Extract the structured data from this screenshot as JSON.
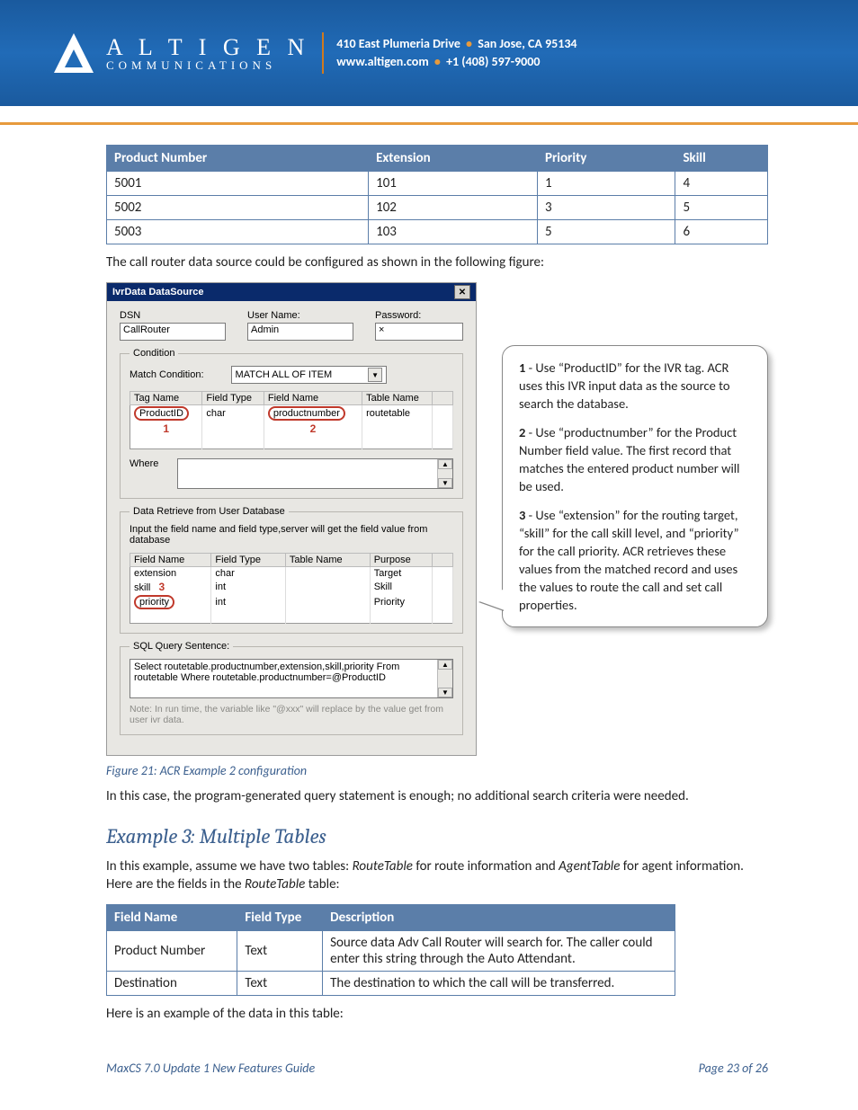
{
  "header": {
    "company_top": "A L T I G E N",
    "company_sub": "COMMUNICATIONS",
    "address_line1_a": "410 East Plumeria Drive",
    "address_line1_b": "San Jose, CA 95134",
    "address_line2_a": "www.altigen.com",
    "address_line2_b": "+1 (408) 597-9000"
  },
  "table1": {
    "headers": [
      "Product Number",
      "Extension",
      "Priority",
      "Skill"
    ],
    "rows": [
      [
        "5001",
        "101",
        "1",
        "4"
      ],
      [
        "5002",
        "102",
        "3",
        "5"
      ],
      [
        "5003",
        "103",
        "5",
        "6"
      ]
    ]
  },
  "para_after_t1": "The call router data source could be configured as shown in the following figure:",
  "dialog": {
    "title": "IvrData DataSource",
    "dsn_label": "DSN",
    "dsn_value": "CallRouter",
    "user_label": "User Name:",
    "user_value": "Admin",
    "pw_label": "Password:",
    "pw_value": "×",
    "cond_legend": "Condition",
    "match_label": "Match Condition:",
    "match_value": "MATCH ALL OF ITEM",
    "cond_headers": [
      "Tag Name",
      "Field Type",
      "Field Name",
      "Table Name"
    ],
    "cond_row": [
      "ProductID",
      "char",
      "productnumber",
      "routetable"
    ],
    "where_label": "Where",
    "retrieve_legend": "Data Retrieve from User Database",
    "retrieve_hint": "Input the field name and field type,server will get the field value from database",
    "ret_headers": [
      "Field Name",
      "Field Type",
      "Table Name",
      "Purpose"
    ],
    "ret_rows": [
      [
        "extension",
        "char",
        "",
        "Target"
      ],
      [
        "skill",
        "int",
        "",
        "Skill"
      ],
      [
        "priority",
        "int",
        "",
        "Priority"
      ]
    ],
    "sql_legend": "SQL Query Sentence:",
    "sql_text": "Select routetable.productnumber,extension,skill,priority From routetable Where routetable.productnumber=@ProductID",
    "note": "Note: In run time, the variable like \"@xxx\" will replace by the value get from user ivr data.",
    "red1": "1",
    "red2": "2",
    "red3": "3"
  },
  "callout": {
    "p1_num": "1",
    "p1_text": " - Use “ProductID” for the IVR tag. ACR uses this IVR input data as the source to search the database.",
    "p2_num": "2",
    "p2_text": " - Use “productnumber” for the Product Number field value. The first record that matches the entered product number will be used.",
    "p3_num": "3",
    "p3_text": " - Use “extension” for the routing target, “skill” for the call skill level, and “priority” for the call priority. ACR retrieves these values from the matched record and uses the values to route the call and set call properties."
  },
  "figure_caption": "Figure 21: ACR Example 2 configuration",
  "para_after_fig": "In this case, the program-generated query statement is enough; no additional search criteria were needed.",
  "heading_ex3": "Example 3: Multiple Tables",
  "para_ex3_a": "In this example, assume we have two tables: ",
  "para_ex3_rt": "RouteTable",
  "para_ex3_b": " for route information and ",
  "para_ex3_at": "AgentTable",
  "para_ex3_c": " for agent information. Here are the fields in the ",
  "para_ex3_rt2": "RouteTable",
  "para_ex3_d": " table:",
  "table2": {
    "headers": [
      "Field Name",
      "Field Type",
      "Description"
    ],
    "rows": [
      [
        "Product Number",
        "Text",
        "Source data Adv Call Router will search for. The caller could enter this string through the Auto Attendant."
      ],
      [
        "Destination",
        "Text",
        "The destination to which the call will be transferred."
      ]
    ]
  },
  "para_after_t2": "Here is an example of the data in this table:",
  "footer": {
    "left": "MaxCS 7.0 Update 1 New Features Guide",
    "right": "Page 23 of 26"
  }
}
